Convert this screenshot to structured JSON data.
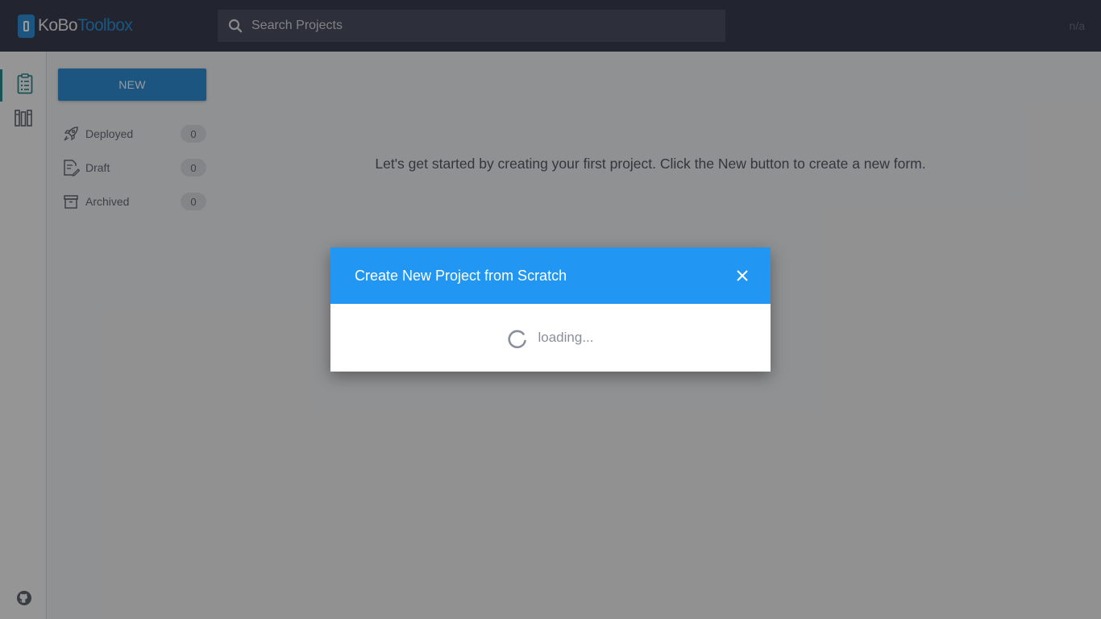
{
  "header": {
    "logo": {
      "part1": "KoBo",
      "part2": "Toolbox"
    },
    "search_placeholder": "Search Projects",
    "user": "n/a"
  },
  "rail": {
    "items": [
      {
        "name": "projects",
        "icon": "clipboard-icon",
        "active": true
      },
      {
        "name": "library",
        "icon": "library-icon",
        "active": false
      }
    ],
    "footer_icon": "github-icon"
  },
  "sidebar": {
    "new_label": "NEW",
    "items": [
      {
        "label": "Deployed",
        "count": "0",
        "icon": "rocket-icon"
      },
      {
        "label": "Draft",
        "count": "0",
        "icon": "draft-icon"
      },
      {
        "label": "Archived",
        "count": "0",
        "icon": "archive-icon"
      }
    ]
  },
  "main": {
    "empty_message": "Let's get started by creating your first project. Click the New button to create a new form."
  },
  "modal": {
    "title": "Create New Project from Scratch",
    "loading": "loading..."
  },
  "colors": {
    "header_bg": "#3a3f4f",
    "accent": "#2f8fd6",
    "modal_header": "#2196f3",
    "rail_active": "#2c8a8e"
  }
}
